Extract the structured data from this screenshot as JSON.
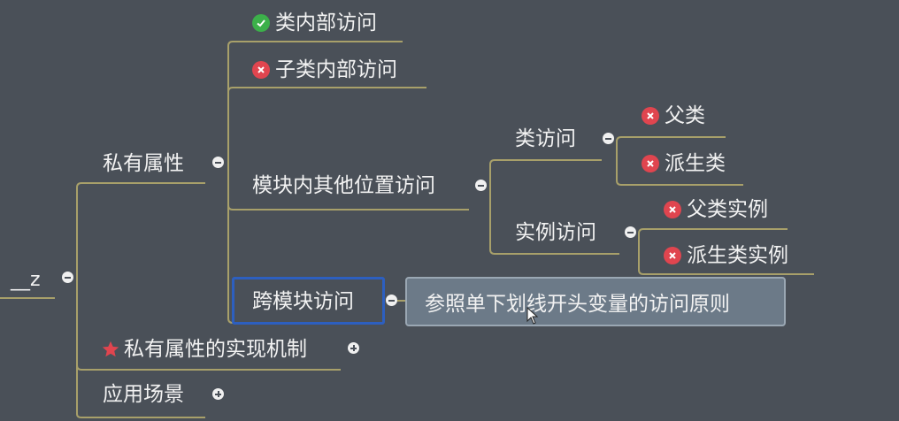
{
  "root": {
    "label": "__z"
  },
  "branches": {
    "private_attr": {
      "label": "私有属性"
    },
    "class_internal": {
      "label": "类内部访问",
      "icon": "check-icon"
    },
    "subclass_internal": {
      "label": "子类内部访问",
      "icon": "cross-icon"
    },
    "module_other": {
      "label": "模块内其他位置访问"
    },
    "class_access": {
      "label": "类访问"
    },
    "parent_class": {
      "label": "父类",
      "icon": "cross-icon"
    },
    "derived_class": {
      "label": "派生类",
      "icon": "cross-icon"
    },
    "instance_access": {
      "label": "实例访问"
    },
    "parent_instance": {
      "label": "父类实例",
      "icon": "cross-icon"
    },
    "derived_instance": {
      "label": "派生类实例",
      "icon": "cross-icon"
    },
    "cross_module": {
      "label": "跨模块访问"
    },
    "cross_module_note": {
      "label": "参照单下划线开头变量的访问原则"
    },
    "impl_mechanism": {
      "label": "私有属性的实现机制",
      "icon": "star-icon"
    },
    "use_cases": {
      "label": "应用场景"
    }
  },
  "colors": {
    "background": "#4a5058",
    "connector": "#a8a06a",
    "check": "#3cb04a",
    "cross": "#e0454f",
    "star": "#e0454f",
    "selection": "#2d5fbf"
  }
}
